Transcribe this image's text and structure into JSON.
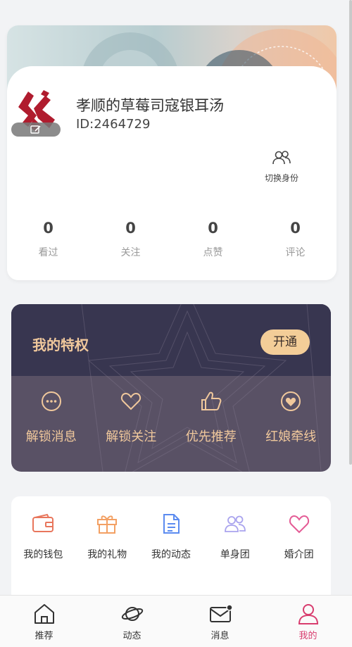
{
  "colors": {
    "accent": "#d83c6e",
    "gold": "#f0c89c",
    "button_gold": "#f3cd98",
    "priv_dark": "#383650",
    "priv_mid": "#595165"
  },
  "profile": {
    "nickname": "孝顺的草莓司寇银耳汤",
    "user_id": "ID:2464729",
    "avatar_icon": "logo-avatar",
    "edit_icon": "edit-icon",
    "switch_identity": {
      "label": "切换身份",
      "icon": "users-icon"
    },
    "stats": [
      {
        "value": "0",
        "label": "看过"
      },
      {
        "value": "0",
        "label": "关注"
      },
      {
        "value": "0",
        "label": "点赞"
      },
      {
        "value": "0",
        "label": "评论"
      }
    ]
  },
  "privilege": {
    "title": "我的特权",
    "open_button": "开通",
    "items": [
      {
        "label": "解锁消息",
        "icon": "chat-bubble-icon"
      },
      {
        "label": "解锁关注",
        "icon": "heart-outline-icon"
      },
      {
        "label": "优先推荐",
        "icon": "thumbs-up-icon"
      },
      {
        "label": "红娘牵线",
        "icon": "heart-circle-icon"
      }
    ]
  },
  "services": [
    {
      "label": "我的钱包",
      "icon": "wallet-icon",
      "color": "#e8765c"
    },
    {
      "label": "我的礼物",
      "icon": "gift-icon",
      "color": "#f3a063"
    },
    {
      "label": "我的动态",
      "icon": "document-icon",
      "color": "#5b8bf0"
    },
    {
      "label": "单身团",
      "icon": "group-icon",
      "color": "#a9a3ee"
    },
    {
      "label": "婚介团",
      "icon": "heart-icon",
      "color": "#e45b95"
    }
  ],
  "tabbar": [
    {
      "label": "推荐",
      "icon": "home-icon",
      "active": false
    },
    {
      "label": "动态",
      "icon": "planet-icon",
      "active": false
    },
    {
      "label": "消息",
      "icon": "mail-icon",
      "active": false
    },
    {
      "label": "我的",
      "icon": "user-icon",
      "active": true
    }
  ]
}
